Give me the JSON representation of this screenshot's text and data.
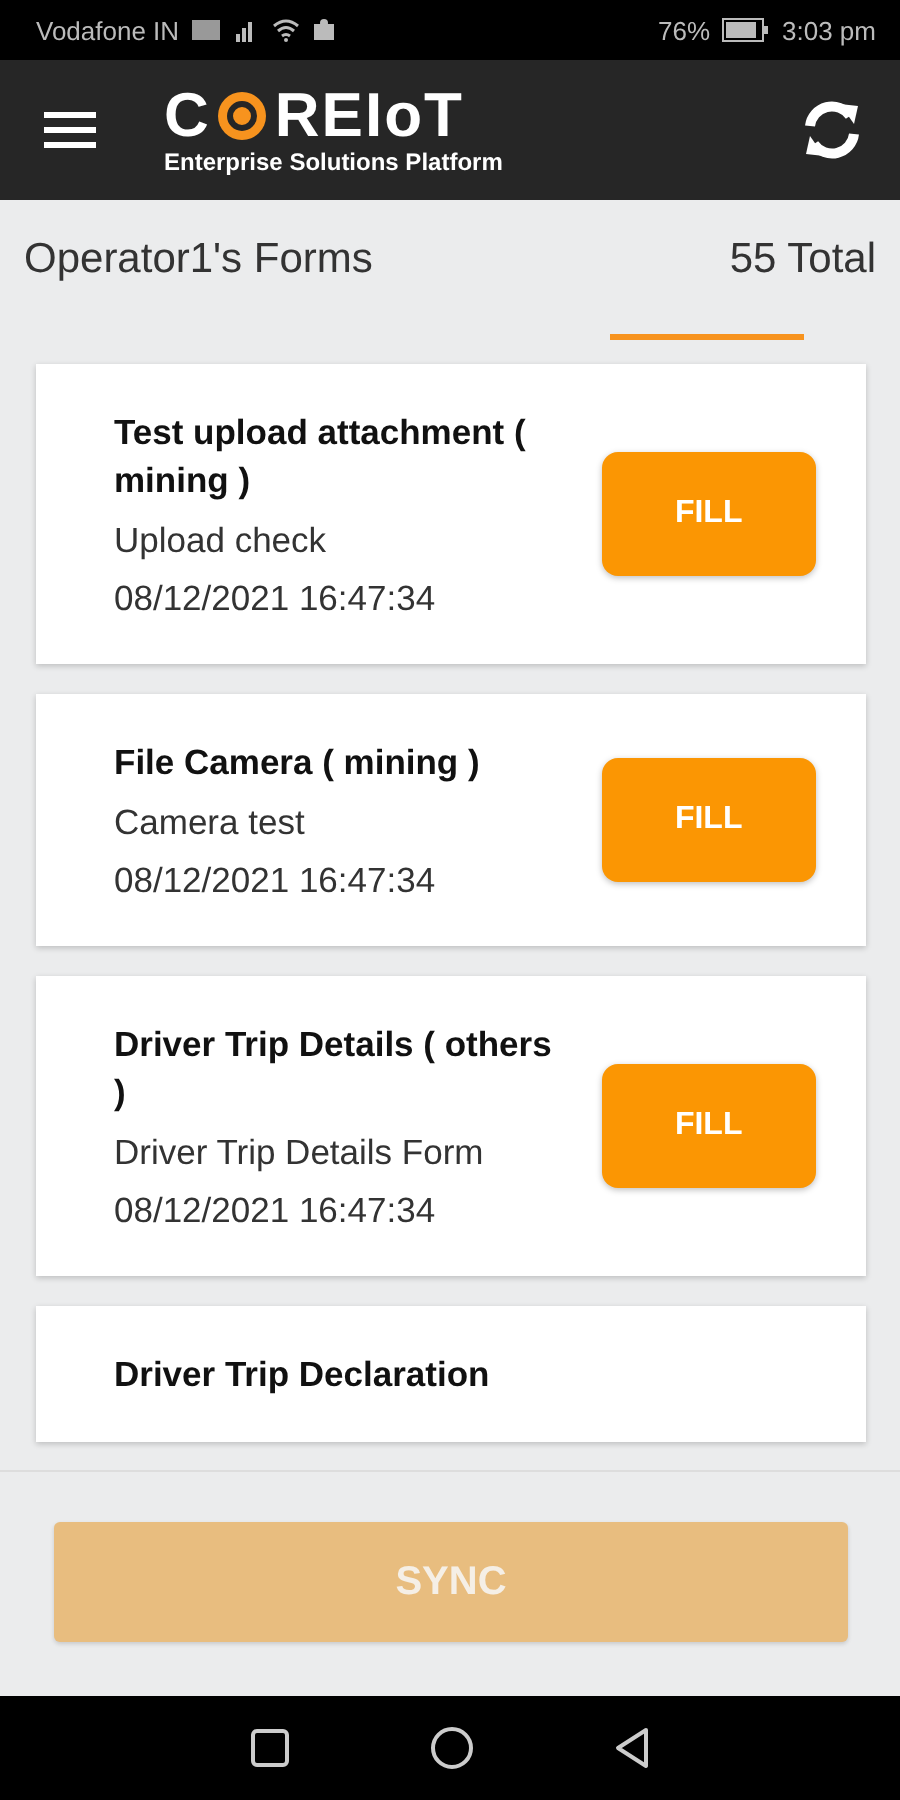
{
  "status_bar": {
    "carrier": "Vodafone IN",
    "battery": "76%",
    "time": "3:03 pm"
  },
  "app_bar": {
    "logo_start": "C",
    "logo_end": "REIoT",
    "tagline": "Enterprise Solutions Platform"
  },
  "header": {
    "title": "Operator1's Forms",
    "total": "55 Total"
  },
  "forms": [
    {
      "title": "Test upload attachment ( mining )",
      "description": "Upload check",
      "date": "08/12/2021 16:47:34",
      "button": "FILL"
    },
    {
      "title": "File Camera  ( mining )",
      "description": "Camera test",
      "date": "08/12/2021 16:47:34",
      "button": "FILL"
    },
    {
      "title": "Driver Trip Details ( others )",
      "description": "Driver Trip Details Form",
      "date": "08/12/2021 16:47:34",
      "button": "FILL"
    },
    {
      "title": "Driver Trip Declaration"
    }
  ],
  "sync_button": {
    "label": "SYNC",
    "disabled": true
  }
}
